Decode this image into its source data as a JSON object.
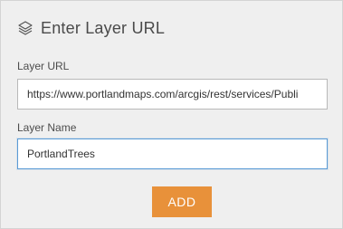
{
  "header": {
    "icon": "layers-icon",
    "title": "Enter Layer URL"
  },
  "form": {
    "url_label": "Layer URL",
    "url_value": "https://www.portlandmaps.com/arcgis/rest/services/Publi",
    "name_label": "Layer Name",
    "name_value": "PortlandTrees"
  },
  "actions": {
    "add_label": "ADD"
  },
  "colors": {
    "panel_bg": "#efefef",
    "accent_button": "#e8913a",
    "focus_border": "#5b9bd5"
  }
}
